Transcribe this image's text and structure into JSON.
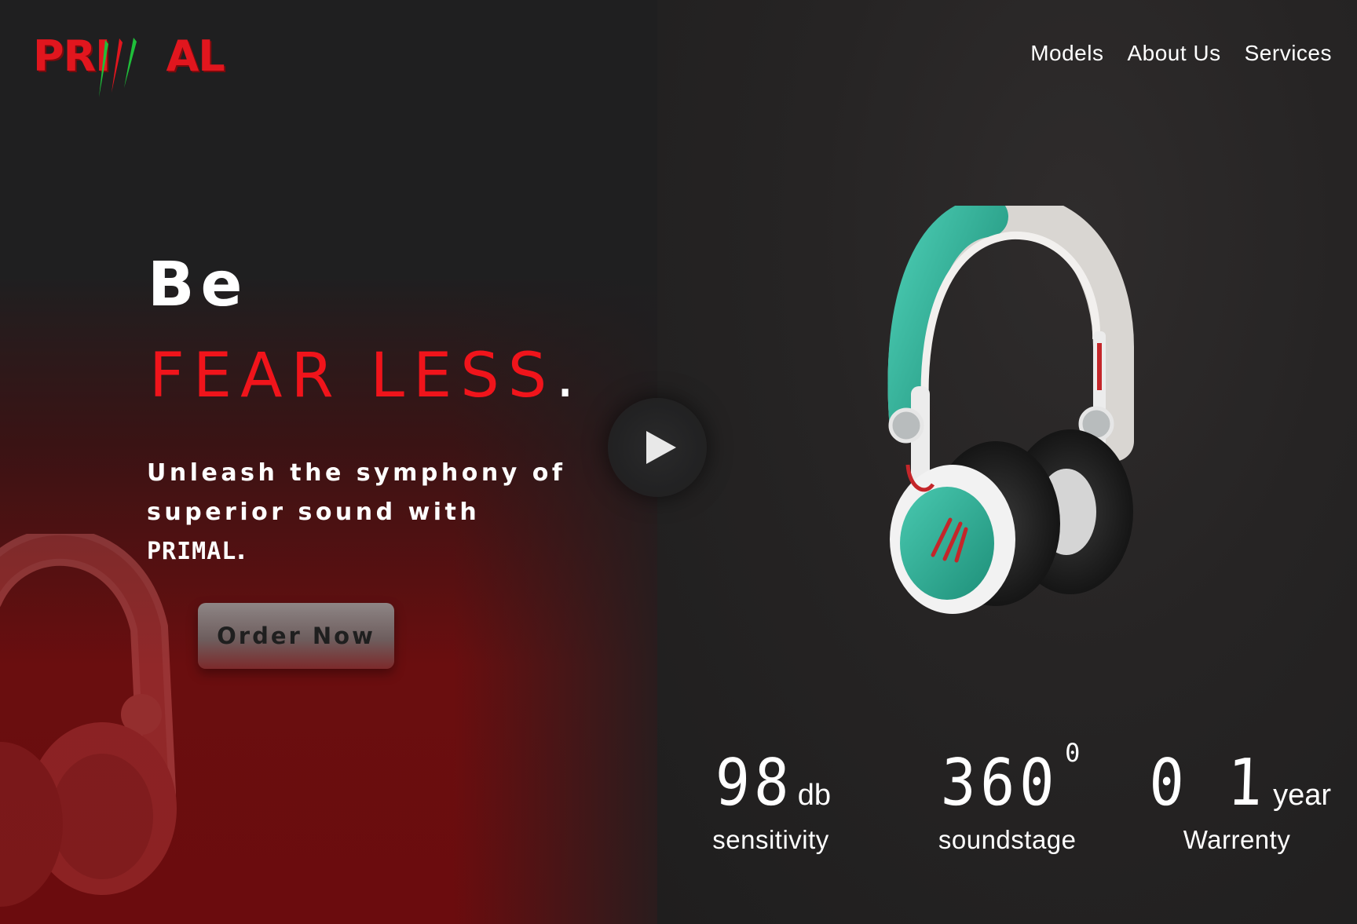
{
  "brand": {
    "logo_text": "PRIMAL"
  },
  "nav": {
    "items": [
      "Models",
      "About Us",
      "Services"
    ]
  },
  "hero": {
    "line1": "Be",
    "line2": "FEAR LESS",
    "line2_punct": ".",
    "tagline_part1": "Unleash the symphony of superior sound with ",
    "tagline_brand": "PRIMAL",
    "tagline_end": ".",
    "cta_label": "Order Now"
  },
  "colors": {
    "accent_red": "#f0141b",
    "logo_green": "#1fbf3a",
    "headphone_teal": "#2fb59a"
  },
  "stats": [
    {
      "value": "98",
      "unit": "db",
      "label": "sensitivity"
    },
    {
      "value": "360",
      "unit": "0",
      "label": "soundstage"
    },
    {
      "value": "0 1",
      "unit": "year",
      "label": "Warrenty"
    }
  ],
  "icons": {
    "play": "play-icon"
  }
}
